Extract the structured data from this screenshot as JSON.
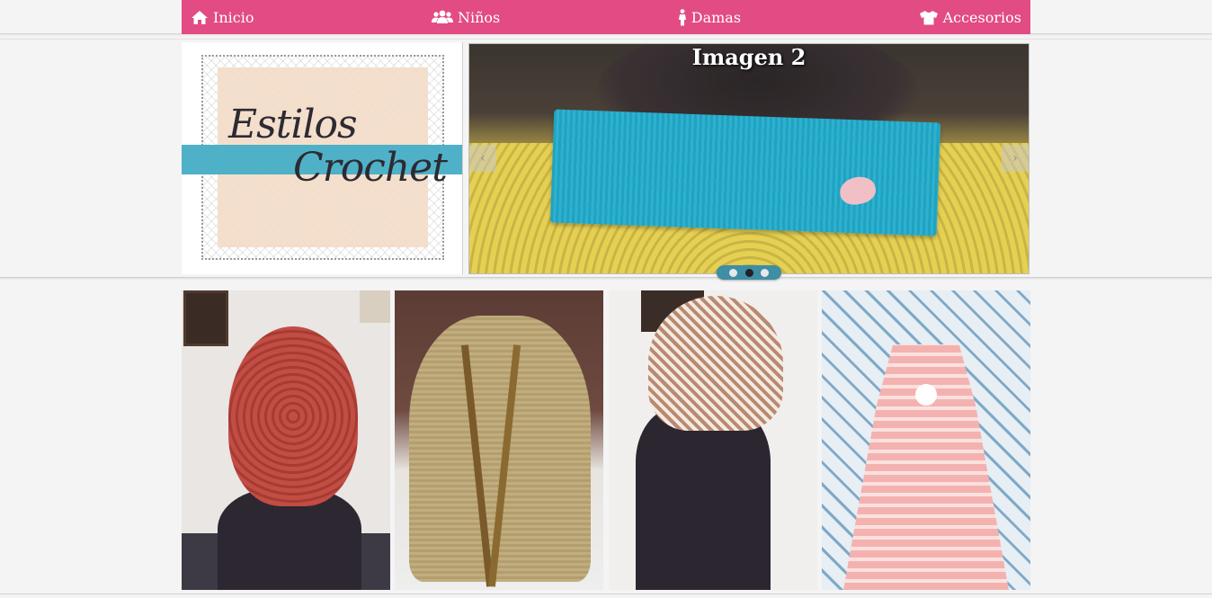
{
  "nav": {
    "items": [
      {
        "label": "Inicio",
        "icon": "home-icon"
      },
      {
        "label": "Niños",
        "icon": "users-icon"
      },
      {
        "label": "Damas",
        "icon": "female-icon"
      },
      {
        "label": "Accesorios",
        "icon": "shirt-icon"
      }
    ]
  },
  "logo": {
    "line1": "Estilos",
    "line2": "Crochet"
  },
  "slider": {
    "title": "Imagen 2",
    "prev_label": "‹",
    "next_label": "›",
    "total_slides": 3,
    "active_index": 1
  },
  "gallery": {
    "items": [
      {
        "subject": "knit red slouchy hat"
      },
      {
        "subject": "crochet drawstring bag"
      },
      {
        "subject": "crochet lace hat"
      },
      {
        "subject": "pink crochet baby dress"
      }
    ]
  },
  "colors": {
    "nav_bg": "#e24b83",
    "page_bg": "#f4f4f4",
    "accent_blue": "#3e8ea5"
  }
}
